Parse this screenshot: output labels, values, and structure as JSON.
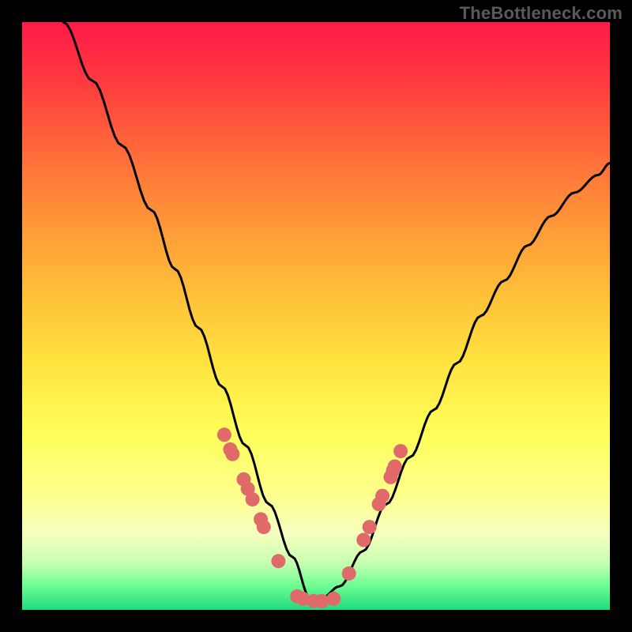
{
  "watermark": "TheBottleneck.com",
  "colors": {
    "frame": "#000000",
    "curve": "#000000",
    "dot": "#e06a6a",
    "gradient_top": "#ff1a48",
    "gradient_bottom": "#1fd97b"
  },
  "chart_data": {
    "type": "line",
    "title": "",
    "xlabel": "",
    "ylabel": "",
    "xlim": [
      0,
      100
    ],
    "ylim": [
      0,
      100
    ],
    "grid": false,
    "legend": false,
    "series": [
      {
        "name": "bottleneck-curve",
        "x": [
          7,
          12,
          17,
          22,
          26,
          30,
          34,
          38,
          42,
          46,
          49,
          51,
          54,
          58,
          62,
          66,
          70,
          74,
          78,
          82,
          86,
          90,
          94,
          98,
          100
        ],
        "values": [
          100,
          90,
          79,
          68,
          58,
          48,
          38,
          28,
          18,
          9,
          2,
          2,
          4,
          10,
          18,
          26,
          34,
          42,
          50,
          56,
          62,
          67,
          71,
          74,
          76
        ]
      }
    ],
    "annotations": {
      "notch_x_range": [
        46,
        54
      ],
      "description": "V-shaped bottleneck curve with near-zero minimum around x≈50 on a vertical red-to-green gradient background."
    },
    "scatter_points": {
      "name": "highlighted-points",
      "x": [
        34.4,
        35.4,
        35.8,
        37.7,
        38.4,
        39.2,
        40.6,
        41.1,
        43.6,
        46.8,
        47.8,
        49.6,
        51.0,
        53.0,
        55.6,
        58.1,
        59.1,
        60.7,
        61.3,
        62.7,
        63.1,
        63.4,
        64.4
      ],
      "values": [
        29.8,
        27.3,
        26.5,
        22.2,
        20.6,
        18.8,
        15.4,
        14.1,
        8.3,
        2.3,
        1.9,
        1.5,
        1.5,
        1.9,
        6.2,
        11.9,
        14.1,
        18.0,
        19.4,
        22.6,
        23.7,
        24.4,
        27.0
      ]
    }
  }
}
